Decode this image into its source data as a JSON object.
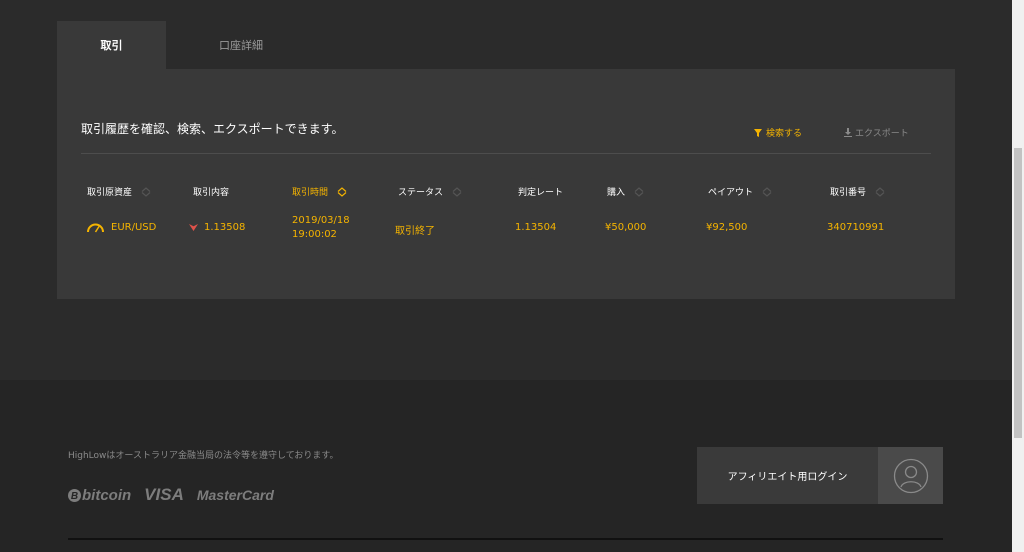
{
  "tabs": [
    {
      "label": "取引",
      "active": true
    },
    {
      "label": "口座詳細",
      "active": false
    }
  ],
  "panel": {
    "description": "取引履歴を確認、検索、エクスポートできます。",
    "search_label": "検索する",
    "export_label": "エクスポート"
  },
  "table": {
    "columns": [
      "取引原資産",
      "取引内容",
      "取引時間",
      "ステータス",
      "判定レート",
      "購入",
      "ペイアウト",
      "取引番号"
    ],
    "sorted_column": "取引時間",
    "rows": [
      {
        "asset": "EUR/USD",
        "direction": "down",
        "entry_rate": "1.13508",
        "time_date": "2019/03/18",
        "time_clock": "19:00:02",
        "status": "取引終了",
        "closing_rate": "1.13504",
        "investment": "¥50,000",
        "payout": "¥92,500",
        "trade_id": "340710991"
      }
    ]
  },
  "footer": {
    "legal_text": "HighLowはオーストラリア金融当局の法令等を遵守しております。",
    "payment_bitcoin": "bitcoin",
    "payment_visa": "VISA",
    "payment_mastercard": "MasterCard",
    "affiliate_login": "アフィリエイト用ログイン"
  },
  "colors": {
    "accent": "#f5b400",
    "direction_down": "#e0524a",
    "background": "#2b2b2b",
    "panel": "#393939",
    "footer": "#252525"
  },
  "icons": {
    "search": "filter-icon",
    "export": "download-icon",
    "asset": "gauge-icon",
    "direction": "down-arrow-icon",
    "affiliate": "user-avatar-icon"
  }
}
